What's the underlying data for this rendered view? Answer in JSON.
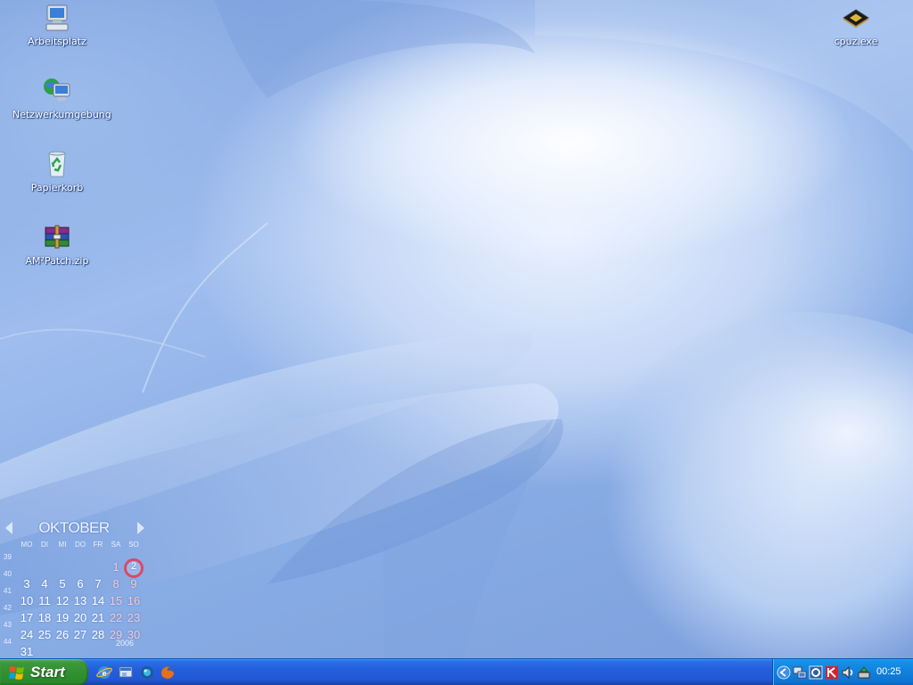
{
  "desktop": {
    "icons": [
      {
        "label": "Arbeitsplatz",
        "icon": "my-computer-icon"
      },
      {
        "label": "Netzwerkumgebung",
        "icon": "network-places-icon"
      },
      {
        "label": "Papierkorb",
        "icon": "recycle-bin-icon"
      },
      {
        "label": "AM²Patch.zip",
        "icon": "winrar-archive-icon"
      },
      {
        "label": "cpuz.exe",
        "icon": "cpu-chip-icon"
      }
    ]
  },
  "calendar": {
    "month": "OKTOBER",
    "year": "2006",
    "weekdays": [
      "MO",
      "DI",
      "MI",
      "DO",
      "FR",
      "SA",
      "SO"
    ],
    "week_numbers": [
      "39",
      "40",
      "41",
      "42",
      "43",
      "44"
    ],
    "weeks": [
      [
        "",
        "",
        "",
        "",
        "",
        "1",
        "2"
      ],
      [
        "3",
        "4",
        "5",
        "6",
        "7",
        "8",
        "9"
      ],
      [
        "10",
        "11",
        "12",
        "13",
        "14",
        "15",
        "16"
      ],
      [
        "17",
        "18",
        "19",
        "20",
        "21",
        "22",
        "23"
      ],
      [
        "24",
        "25",
        "26",
        "27",
        "28",
        "29",
        "30"
      ],
      [
        "31",
        "",
        "",
        "",
        "",
        "",
        ""
      ]
    ],
    "today": "2",
    "highlight_color": "#d84a6a"
  },
  "taskbar": {
    "start_label": "Start",
    "quick_launch": [
      "internet-explorer-icon",
      "show-desktop-icon",
      "media-player-icon",
      "firefox-icon"
    ],
    "tray_icons": [
      "tray-expand-arrow-icon",
      "network-connection-icon",
      "tray-app-icon",
      "antivirus-icon",
      "volume-icon",
      "safely-remove-hardware-icon"
    ],
    "clock": "00:25"
  },
  "colors": {
    "taskbar_blue": "#245edb",
    "start_green": "#329032",
    "tray_blue": "#1280dc"
  }
}
